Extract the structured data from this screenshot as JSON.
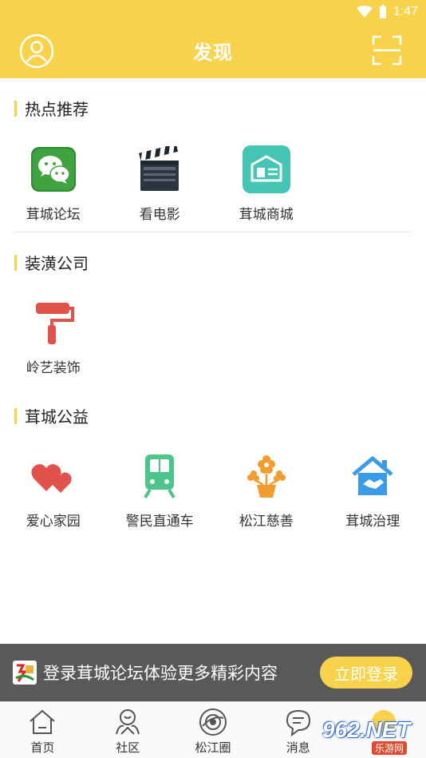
{
  "status_bar": {
    "time": "1:47"
  },
  "header": {
    "title": "发现",
    "accent": "#f9d24b"
  },
  "sections": [
    {
      "title": "热点推荐",
      "items": [
        {
          "label": "茸城论坛",
          "icon": "wechat-icon"
        },
        {
          "label": "看电影",
          "icon": "clapperboard-icon"
        },
        {
          "label": "茸城商城",
          "icon": "store-icon"
        }
      ]
    },
    {
      "title": "装潢公司",
      "items": [
        {
          "label": "岭艺装饰",
          "icon": "paint-roller-icon"
        }
      ]
    },
    {
      "title": "茸城公益",
      "items": [
        {
          "label": "爱心家园",
          "icon": "hearts-icon"
        },
        {
          "label": "警民直通车",
          "icon": "train-icon"
        },
        {
          "label": "松江慈善",
          "icon": "flower-pot-icon"
        },
        {
          "label": "茸城治理",
          "icon": "house-handshake-icon"
        }
      ]
    }
  ],
  "login_banner": {
    "message": "登录茸城论坛体验更多精彩内容",
    "button": "立即登录"
  },
  "tabbar": [
    {
      "label": "首页",
      "icon": "home-icon"
    },
    {
      "label": "社区",
      "icon": "community-icon"
    },
    {
      "label": "松江圈",
      "icon": "circle-icon"
    },
    {
      "label": "消息",
      "icon": "message-icon"
    },
    {
      "label": "",
      "icon": "discover-icon"
    }
  ],
  "watermark": {
    "text": "962.NET",
    "sub": "乐游网"
  }
}
